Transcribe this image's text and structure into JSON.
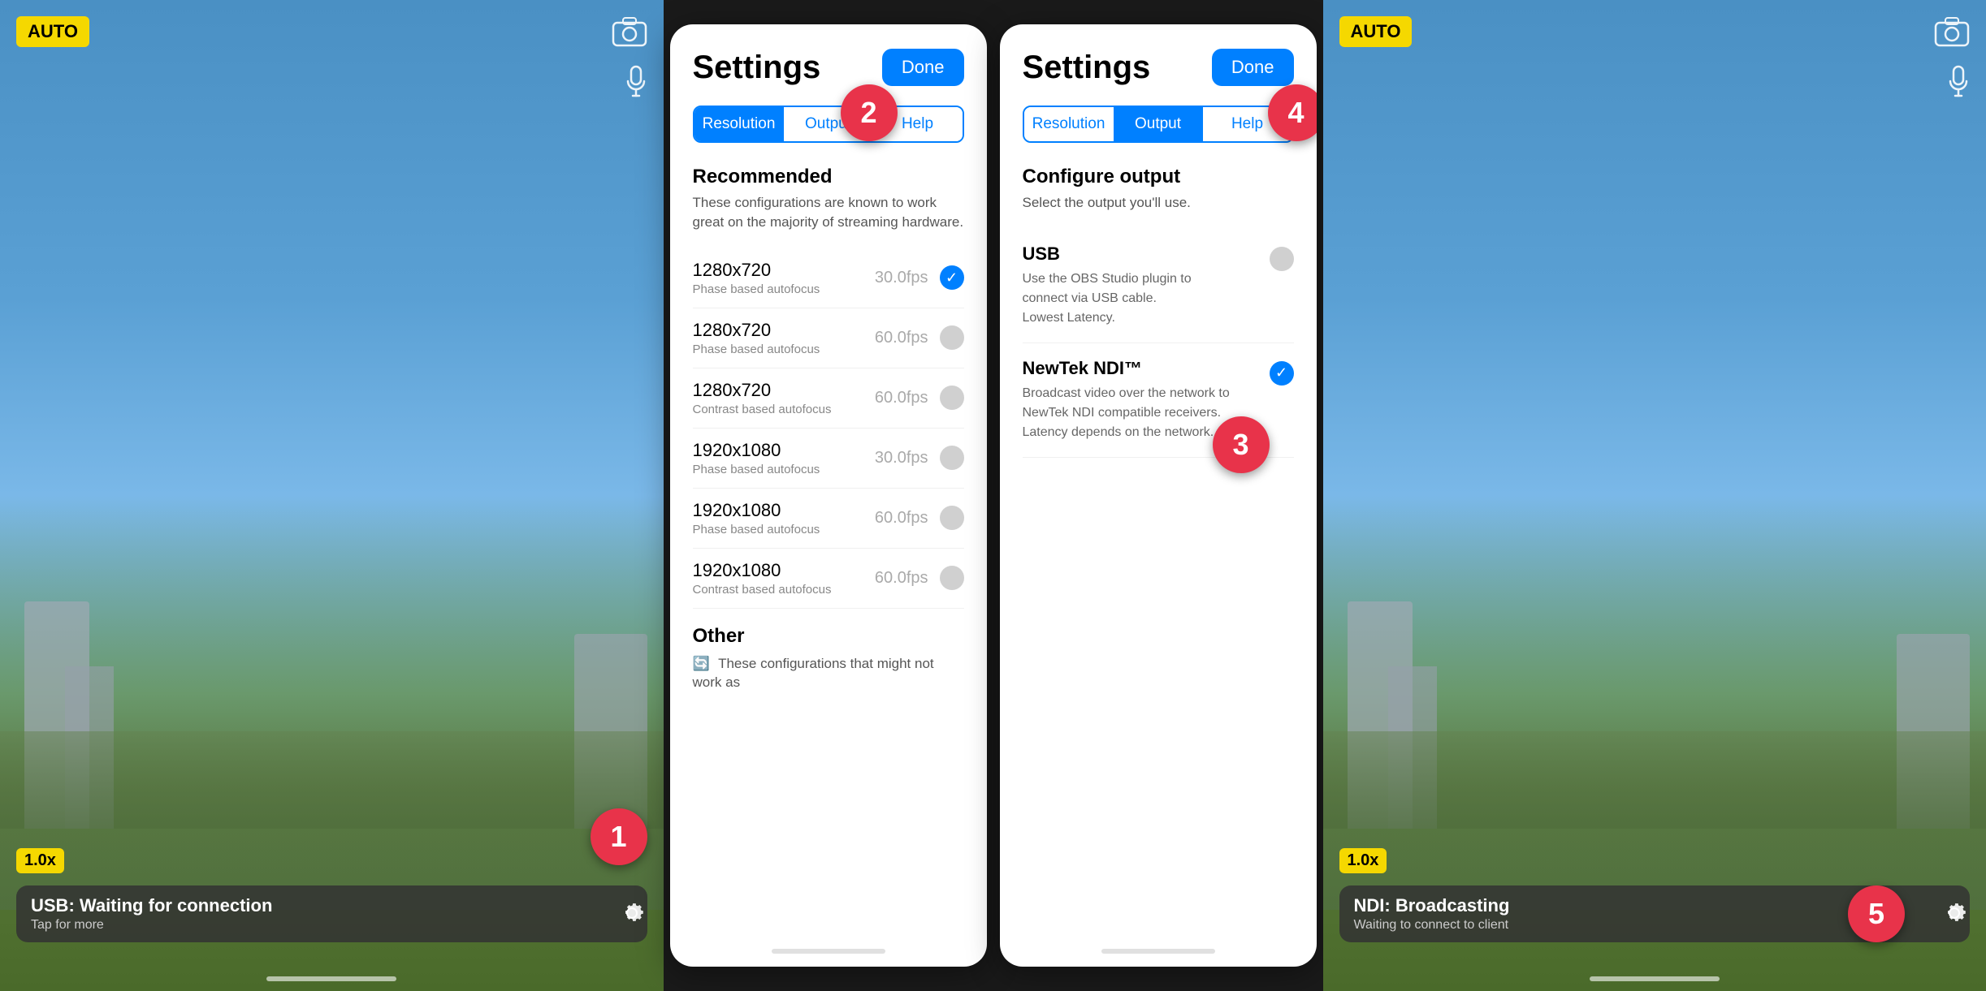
{
  "screen1": {
    "auto_label": "AUTO",
    "zoom_label": "1.0x",
    "status_title": "USB: Waiting for connection",
    "status_sub": "Tap for more",
    "step": "1"
  },
  "screen4": {
    "auto_label": "AUTO",
    "zoom_label": "1.0x",
    "status_title": "NDI: Broadcasting",
    "status_sub": "Waiting to connect to client",
    "step": "5"
  },
  "settings_left": {
    "title": "Settings",
    "step": "2",
    "done_label": "Done",
    "tabs": [
      {
        "label": "Resolution",
        "active": true
      },
      {
        "label": "Output",
        "active": false
      },
      {
        "label": "Help",
        "active": false
      }
    ],
    "recommended_title": "Recommended",
    "recommended_desc": "These configurations are known to work great on the majority of streaming hardware.",
    "resolutions": [
      {
        "name": "1280x720",
        "sub": "Phase based autofocus",
        "fps": "30.0fps",
        "selected": true
      },
      {
        "name": "1280x720",
        "sub": "Phase based autofocus",
        "fps": "60.0fps",
        "selected": false
      },
      {
        "name": "1280x720",
        "sub": "Contrast based autofocus",
        "fps": "60.0fps",
        "selected": false
      },
      {
        "name": "1920x1080",
        "sub": "Phase based autofocus",
        "fps": "30.0fps",
        "selected": false
      },
      {
        "name": "1920x1080",
        "sub": "Phase based autofocus",
        "fps": "60.0fps",
        "selected": false
      },
      {
        "name": "1920x1080",
        "sub": "Contrast based autofocus",
        "fps": "60.0fps",
        "selected": false
      }
    ],
    "other_title": "Other",
    "other_desc": "These configurations that might not work as"
  },
  "settings_right": {
    "title": "Settings",
    "step": "4",
    "done_label": "Done",
    "tabs": [
      {
        "label": "Resolution",
        "active": false
      },
      {
        "label": "Output",
        "active": true
      },
      {
        "label": "Help",
        "active": false
      }
    ],
    "configure_title": "Configure output",
    "configure_desc": "Select the output you'll use.",
    "outputs": [
      {
        "name": "USB",
        "desc": "Use the OBS Studio plugin to connect via USB cable.\nLowest Latency.",
        "selected": false
      },
      {
        "name": "NewTek NDI™",
        "desc": "Broadcast video over the network to NewTek NDI compatible receivers. Latency depends on the network.",
        "selected": true
      }
    ],
    "step3": "3"
  },
  "icons": {
    "camera": "⊡",
    "mic": "🎤",
    "gear": "⚙",
    "checkmark": "✓"
  }
}
